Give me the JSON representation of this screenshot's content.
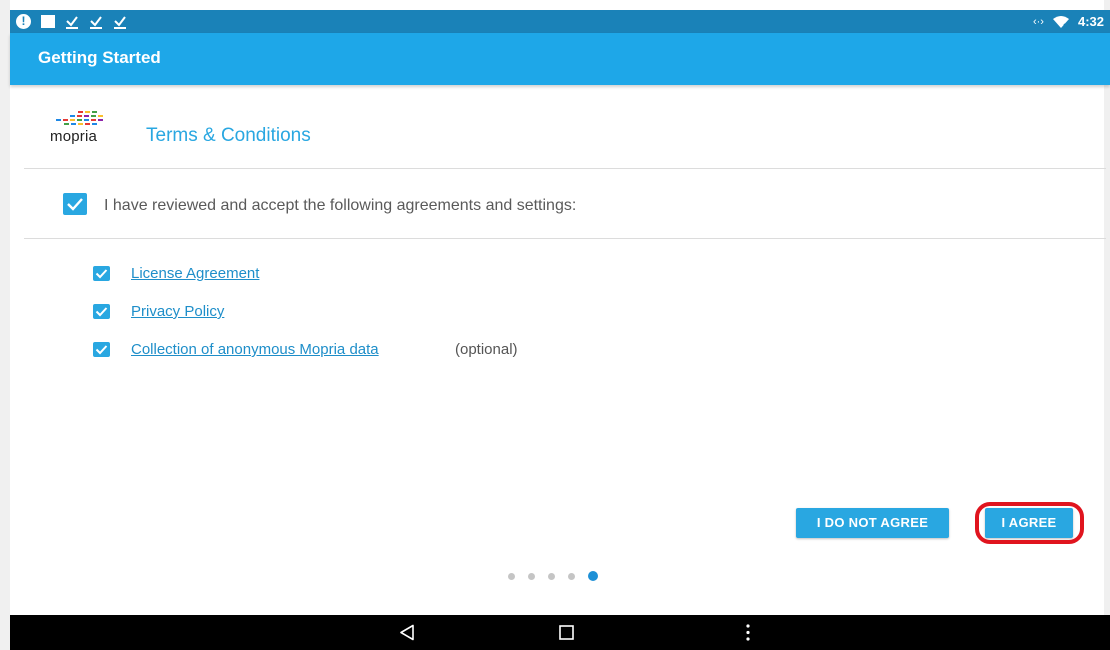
{
  "status_bar": {
    "time": "4:32",
    "sync_glyph": "‹·›",
    "icons": [
      "alert-icon",
      "square-icon",
      "download-icon",
      "download-icon",
      "download-icon",
      "sync-icon",
      "wifi-icon"
    ]
  },
  "app_bar": {
    "title": "Getting Started"
  },
  "header": {
    "logo_text": "mopria",
    "title": "Terms & Conditions"
  },
  "main_checkbox": {
    "checked": true,
    "label": "I have reviewed and accept the following agreements and settings:"
  },
  "agreements": [
    {
      "label": "License Agreement",
      "checked": true
    },
    {
      "label": "Privacy Policy",
      "checked": true
    },
    {
      "label": "Collection of anonymous Mopria data",
      "suffix": "(optional)",
      "checked": true
    }
  ],
  "buttons": {
    "disagree": "I DO NOT AGREE",
    "agree": "I AGREE"
  },
  "pager": {
    "total": 5,
    "current": 5
  },
  "colors": {
    "status_bar": "#1a82b8",
    "app_bar": "#1ea7e8",
    "accent": "#29a7e1",
    "link": "#1e8ec9",
    "highlight": "#e0141e"
  }
}
